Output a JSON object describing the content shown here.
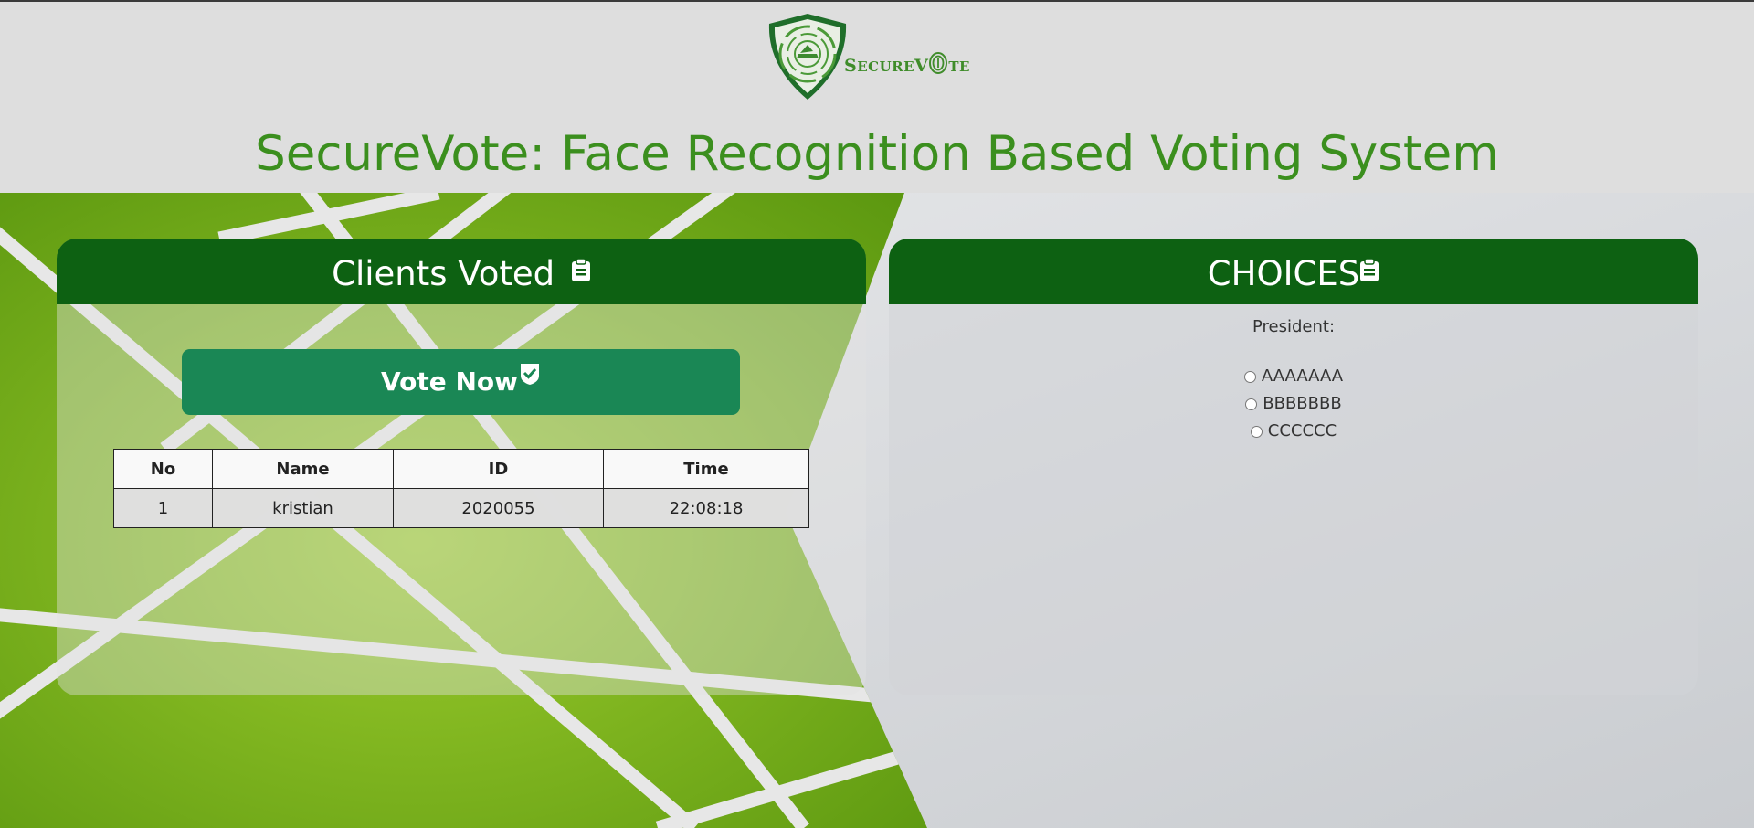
{
  "header": {
    "logo_text_cap1": "S",
    "logo_text_rest1": "ECURE",
    "logo_text_cap2": "V",
    "logo_text_rest2": "TE",
    "title": "SecureVote: Face Recognition Based Voting System"
  },
  "clients_panel": {
    "title": "Clients Voted",
    "vote_button_label": "Vote Now",
    "columns": [
      "No",
      "Name",
      "ID",
      "Time"
    ],
    "rows": [
      [
        "1",
        "kristian",
        "2020055",
        "22:08:18"
      ]
    ]
  },
  "choices_panel": {
    "title": "CHOICES",
    "position_label": "President:",
    "options": [
      "AAAAAAA",
      "BBBBBBB",
      "CCCCCC"
    ]
  },
  "colors": {
    "header_green": "#0d6112",
    "title_green": "#3b8f1e",
    "button_green": "#1a8755",
    "background_lime": "#7fb21a"
  },
  "icons": {
    "clients_title_icon": "clipboard-icon",
    "choices_title_icon": "clipboard-icon",
    "vote_button_icon": "check-shield-icon",
    "logo": "shield-fingerprint-logo"
  }
}
